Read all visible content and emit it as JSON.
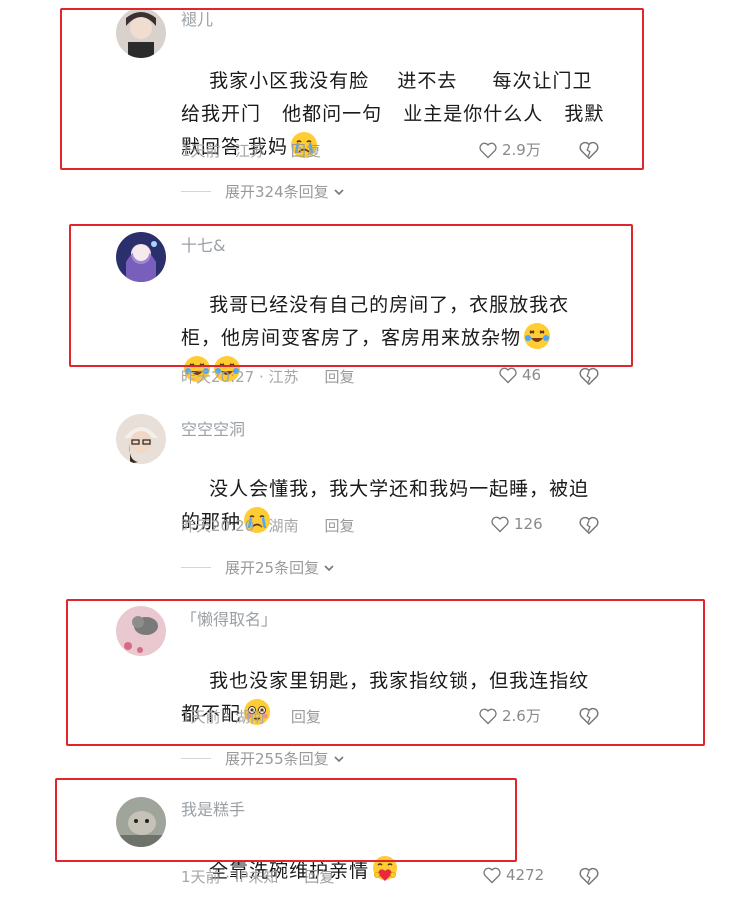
{
  "comments": [
    {
      "author": "褪儿",
      "text": "我家小区我没有脸    进不去     每次让门卫给我开门   他都问一句   业主是你什么人   我默默回答 我妈",
      "emoji": [
        "crying-face"
      ],
      "time_location": "1天前 · 江苏",
      "reply_label": "回复",
      "likes": "2.9万",
      "expand_label": "展开324条回复"
    },
    {
      "author": "十七&",
      "text": "我哥已经没有自己的房间了，衣服放我衣柜，他房间变客房了，客房用来放杂物",
      "emoji": [
        "laughing-crying-face",
        "laughing-crying-face",
        "laughing-crying-face"
      ],
      "time_location": "昨天20:27 · 江苏",
      "reply_label": "回复",
      "likes": "46"
    },
    {
      "author": "空空空洞",
      "text": "没人会懂我，我大学还和我妈一起睡，被迫的那种",
      "emoji": [
        "crying-face"
      ],
      "time_location": "昨天20:20 · 湖南",
      "reply_label": "回复",
      "likes": "126",
      "expand_label": "展开25条回复"
    },
    {
      "author": "「懒得取名」",
      "text": "我也没家里钥匙，我家指纹锁，但我连指纹都不配",
      "emoji": [
        "flushed-face"
      ],
      "time_location": "1天前 · 湖南",
      "reply_label": "回复",
      "likes": "2.6万",
      "expand_label": "展开255条回复"
    },
    {
      "author": "我是糕手",
      "text": "全靠洗碗维护亲情",
      "emoji": [
        "heart-hug-face"
      ],
      "time_location": "1天前 · IP未知",
      "reply_label": "回复",
      "likes": "4272"
    }
  ],
  "colors": {
    "highlight_box": "#e0262c",
    "secondary_text": "#a6a6a6",
    "primary_text": "#1a1a1a"
  }
}
